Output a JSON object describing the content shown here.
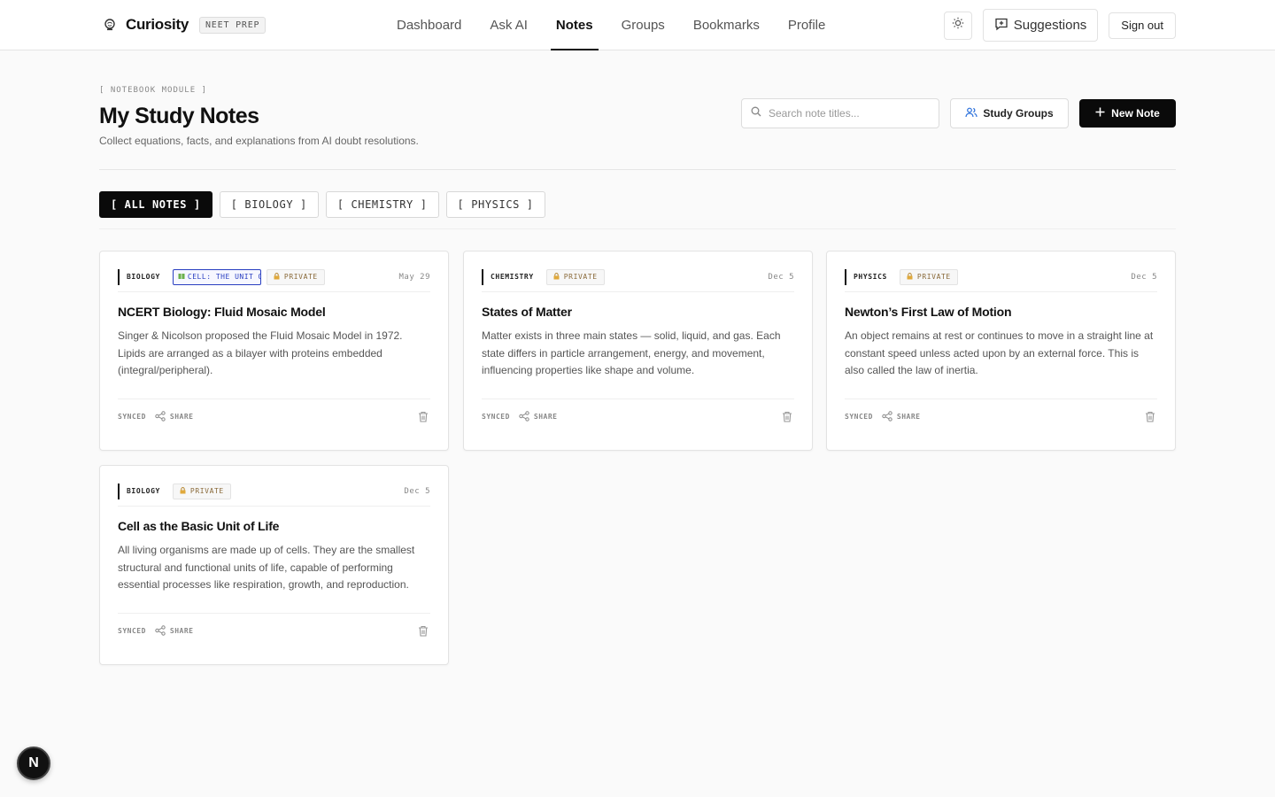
{
  "header": {
    "brand": "Curiosity",
    "badge": "NEET PREP",
    "nav": [
      {
        "label": "Dashboard"
      },
      {
        "label": "Ask AI"
      },
      {
        "label": "Notes"
      },
      {
        "label": "Groups"
      },
      {
        "label": "Bookmarks"
      },
      {
        "label": "Profile"
      }
    ],
    "active_nav": "Notes",
    "suggestions_label": "Suggestions",
    "signout_label": "Sign out"
  },
  "page": {
    "module_label": "[ NOTEBOOK MODULE ]",
    "title": "My Study Notes",
    "subtitle": "Collect equations, facts, and explanations from AI doubt resolutions.",
    "search_placeholder": "Search note titles...",
    "study_groups_label": "Study Groups",
    "new_note_label": "New Note"
  },
  "filters": [
    {
      "label": "[ ALL NOTES ]",
      "active": true
    },
    {
      "label": "[ BIOLOGY ]",
      "active": false
    },
    {
      "label": "[ CHEMISTRY ]",
      "active": false
    },
    {
      "label": "[ PHYSICS ]",
      "active": false
    }
  ],
  "notes": [
    {
      "subject": "BIOLOGY",
      "topic": "CELL: THE UNIT O",
      "privacy": "PRIVATE",
      "date": "May 29",
      "title": "NCERT Biology: Fluid Mosaic Model",
      "body": "Singer & Nicolson proposed the Fluid Mosaic Model in 1972. Lipids are arranged as a bilayer with proteins embedded (integral/peripheral).",
      "synced": "SYNCED",
      "share": "SHARE"
    },
    {
      "subject": "CHEMISTRY",
      "topic": "",
      "privacy": "PRIVATE",
      "date": "Dec 5",
      "title": "States of Matter",
      "body": "Matter exists in three main states — solid, liquid, and gas. Each state differs in particle arrangement, energy, and movement, influencing properties like shape and volume.",
      "synced": "SYNCED",
      "share": "SHARE"
    },
    {
      "subject": "PHYSICS",
      "topic": "",
      "privacy": "PRIVATE",
      "date": "Dec 5",
      "title": "Newton’s First Law of Motion",
      "body": "An object remains at rest or continues to move in a straight line at constant speed unless acted upon by an external force. This is also called the law of inertia.",
      "synced": "SYNCED",
      "share": "SHARE"
    },
    {
      "subject": "BIOLOGY",
      "topic": "",
      "privacy": "PRIVATE",
      "date": "Dec 5",
      "title": "Cell as the Basic Unit of Life",
      "body": "All living organisms are made up of cells. They are the smallest structural and functional units of life, capable of performing essential processes like respiration, growth, and reproduction.",
      "synced": "SYNCED",
      "share": "SHARE"
    }
  ],
  "dev_badge": "N",
  "colors": {
    "accent": "#0a0a0a",
    "topic_tag": "#2a3fc1",
    "background": "#fafafa"
  }
}
